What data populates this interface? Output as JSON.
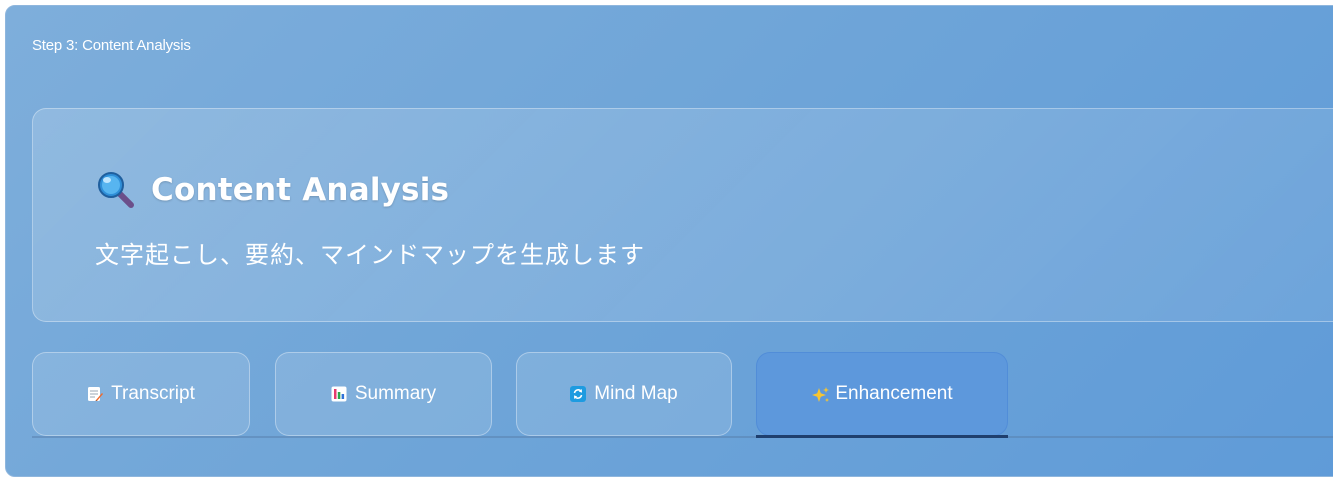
{
  "step": {
    "label": "Step 3: Content Analysis"
  },
  "header": {
    "icon": "magnifier-icon",
    "title": "Content Analysis",
    "subtitle": "文字起こし、要約、マインドマップを生成します"
  },
  "tabs": [
    {
      "label": "Transcript",
      "icon": "memo-icon",
      "active": false
    },
    {
      "label": "Summary",
      "icon": "bar-chart-icon",
      "active": false
    },
    {
      "label": "Mind Map",
      "icon": "refresh-icon",
      "active": false
    },
    {
      "label": "Enhancement",
      "icon": "sparkles-icon",
      "active": true
    }
  ],
  "colors": {
    "background_start": "#7eaedb",
    "background_end": "#5f9bd8",
    "active_tab": "#5d98dc",
    "active_indicator": "#1f3f6e"
  }
}
